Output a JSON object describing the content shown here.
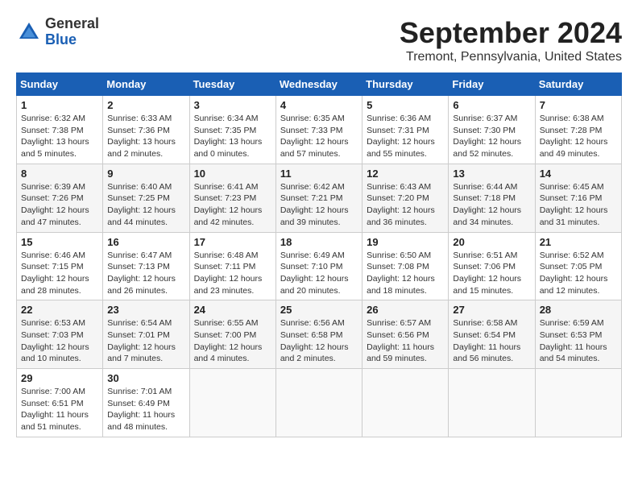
{
  "header": {
    "logo_general": "General",
    "logo_blue": "Blue",
    "month_year": "September 2024",
    "location": "Tremont, Pennsylvania, United States"
  },
  "weekdays": [
    "Sunday",
    "Monday",
    "Tuesday",
    "Wednesday",
    "Thursday",
    "Friday",
    "Saturday"
  ],
  "weeks": [
    [
      {
        "day": "1",
        "info": "Sunrise: 6:32 AM\nSunset: 7:38 PM\nDaylight: 13 hours\nand 5 minutes."
      },
      {
        "day": "2",
        "info": "Sunrise: 6:33 AM\nSunset: 7:36 PM\nDaylight: 13 hours\nand 2 minutes."
      },
      {
        "day": "3",
        "info": "Sunrise: 6:34 AM\nSunset: 7:35 PM\nDaylight: 13 hours\nand 0 minutes."
      },
      {
        "day": "4",
        "info": "Sunrise: 6:35 AM\nSunset: 7:33 PM\nDaylight: 12 hours\nand 57 minutes."
      },
      {
        "day": "5",
        "info": "Sunrise: 6:36 AM\nSunset: 7:31 PM\nDaylight: 12 hours\nand 55 minutes."
      },
      {
        "day": "6",
        "info": "Sunrise: 6:37 AM\nSunset: 7:30 PM\nDaylight: 12 hours\nand 52 minutes."
      },
      {
        "day": "7",
        "info": "Sunrise: 6:38 AM\nSunset: 7:28 PM\nDaylight: 12 hours\nand 49 minutes."
      }
    ],
    [
      {
        "day": "8",
        "info": "Sunrise: 6:39 AM\nSunset: 7:26 PM\nDaylight: 12 hours\nand 47 minutes."
      },
      {
        "day": "9",
        "info": "Sunrise: 6:40 AM\nSunset: 7:25 PM\nDaylight: 12 hours\nand 44 minutes."
      },
      {
        "day": "10",
        "info": "Sunrise: 6:41 AM\nSunset: 7:23 PM\nDaylight: 12 hours\nand 42 minutes."
      },
      {
        "day": "11",
        "info": "Sunrise: 6:42 AM\nSunset: 7:21 PM\nDaylight: 12 hours\nand 39 minutes."
      },
      {
        "day": "12",
        "info": "Sunrise: 6:43 AM\nSunset: 7:20 PM\nDaylight: 12 hours\nand 36 minutes."
      },
      {
        "day": "13",
        "info": "Sunrise: 6:44 AM\nSunset: 7:18 PM\nDaylight: 12 hours\nand 34 minutes."
      },
      {
        "day": "14",
        "info": "Sunrise: 6:45 AM\nSunset: 7:16 PM\nDaylight: 12 hours\nand 31 minutes."
      }
    ],
    [
      {
        "day": "15",
        "info": "Sunrise: 6:46 AM\nSunset: 7:15 PM\nDaylight: 12 hours\nand 28 minutes."
      },
      {
        "day": "16",
        "info": "Sunrise: 6:47 AM\nSunset: 7:13 PM\nDaylight: 12 hours\nand 26 minutes."
      },
      {
        "day": "17",
        "info": "Sunrise: 6:48 AM\nSunset: 7:11 PM\nDaylight: 12 hours\nand 23 minutes."
      },
      {
        "day": "18",
        "info": "Sunrise: 6:49 AM\nSunset: 7:10 PM\nDaylight: 12 hours\nand 20 minutes."
      },
      {
        "day": "19",
        "info": "Sunrise: 6:50 AM\nSunset: 7:08 PM\nDaylight: 12 hours\nand 18 minutes."
      },
      {
        "day": "20",
        "info": "Sunrise: 6:51 AM\nSunset: 7:06 PM\nDaylight: 12 hours\nand 15 minutes."
      },
      {
        "day": "21",
        "info": "Sunrise: 6:52 AM\nSunset: 7:05 PM\nDaylight: 12 hours\nand 12 minutes."
      }
    ],
    [
      {
        "day": "22",
        "info": "Sunrise: 6:53 AM\nSunset: 7:03 PM\nDaylight: 12 hours\nand 10 minutes."
      },
      {
        "day": "23",
        "info": "Sunrise: 6:54 AM\nSunset: 7:01 PM\nDaylight: 12 hours\nand 7 minutes."
      },
      {
        "day": "24",
        "info": "Sunrise: 6:55 AM\nSunset: 7:00 PM\nDaylight: 12 hours\nand 4 minutes."
      },
      {
        "day": "25",
        "info": "Sunrise: 6:56 AM\nSunset: 6:58 PM\nDaylight: 12 hours\nand 2 minutes."
      },
      {
        "day": "26",
        "info": "Sunrise: 6:57 AM\nSunset: 6:56 PM\nDaylight: 11 hours\nand 59 minutes."
      },
      {
        "day": "27",
        "info": "Sunrise: 6:58 AM\nSunset: 6:54 PM\nDaylight: 11 hours\nand 56 minutes."
      },
      {
        "day": "28",
        "info": "Sunrise: 6:59 AM\nSunset: 6:53 PM\nDaylight: 11 hours\nand 54 minutes."
      }
    ],
    [
      {
        "day": "29",
        "info": "Sunrise: 7:00 AM\nSunset: 6:51 PM\nDaylight: 11 hours\nand 51 minutes."
      },
      {
        "day": "30",
        "info": "Sunrise: 7:01 AM\nSunset: 6:49 PM\nDaylight: 11 hours\nand 48 minutes."
      },
      {
        "day": "",
        "info": ""
      },
      {
        "day": "",
        "info": ""
      },
      {
        "day": "",
        "info": ""
      },
      {
        "day": "",
        "info": ""
      },
      {
        "day": "",
        "info": ""
      }
    ]
  ]
}
